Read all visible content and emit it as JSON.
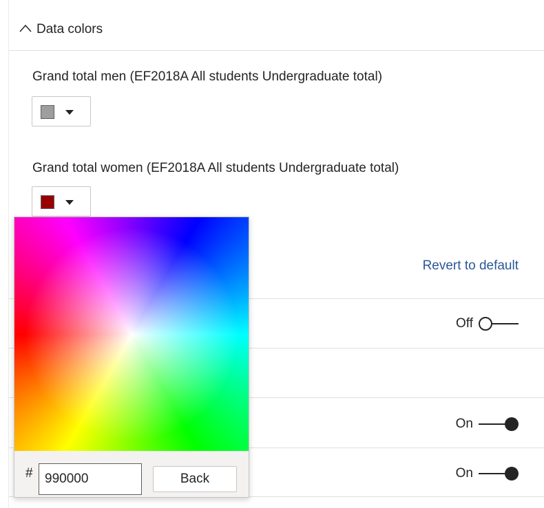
{
  "section": {
    "title": "Data colors",
    "expanded": true
  },
  "fields": [
    {
      "label": "Grand total men (EF2018A All students Undergraduate total)",
      "color": "#9e9e9e"
    },
    {
      "label": "Grand total women (EF2018A All students Undergraduate total)",
      "color": "#990000"
    }
  ],
  "revert_label": "Revert to default",
  "toggles": [
    {
      "label": "Off",
      "state": "off"
    },
    {
      "label": "On",
      "state": "on"
    },
    {
      "label": "On",
      "state": "on"
    }
  ],
  "picker": {
    "hash_symbol": "#",
    "hex_value": "990000",
    "back_label": "Back"
  },
  "colors": {
    "link": "#2b5797",
    "text": "#252423",
    "border": "#c8c6c4"
  }
}
